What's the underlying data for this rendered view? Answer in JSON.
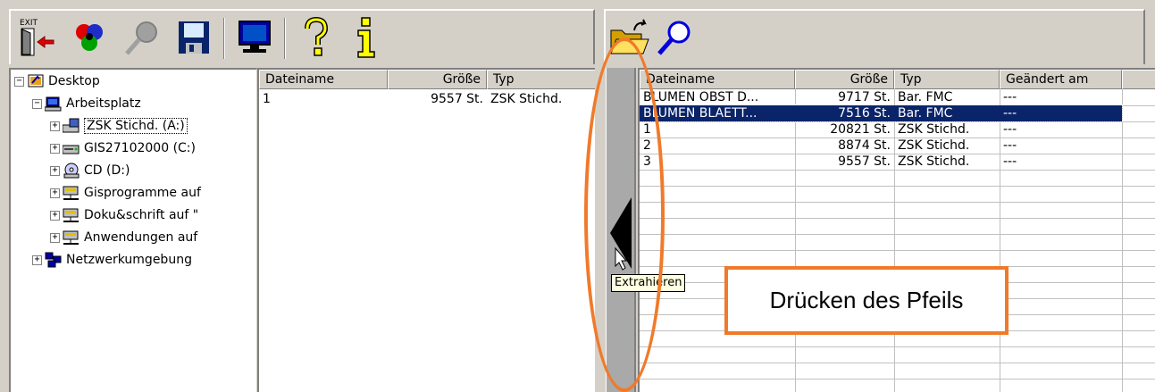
{
  "left_toolbar": {
    "exit_label": "EXIT",
    "icons": [
      "exit-icon",
      "color-circles-icon",
      "magnifier-icon",
      "save-disk-icon",
      "monitor-icon",
      "help-question-icon",
      "info-icon"
    ]
  },
  "right_toolbar": {
    "icons": [
      "open-folder-icon",
      "search-icon"
    ]
  },
  "tree": {
    "items": [
      {
        "label": "Desktop",
        "expander": "−",
        "icon": "desktop-icon"
      },
      {
        "label": "Arbeitsplatz",
        "expander": "−",
        "icon": "computer-icon"
      },
      {
        "label": "ZSK Stichd. (A:)",
        "expander": "+",
        "icon": "floppy-drive-icon"
      },
      {
        "label": "GIS27102000 (C:)",
        "expander": "+",
        "icon": "hard-drive-icon"
      },
      {
        "label": "CD (D:)",
        "expander": "+",
        "icon": "cd-drive-icon"
      },
      {
        "label": "Gisprogramme auf",
        "expander": "+",
        "icon": "network-drive-icon"
      },
      {
        "label": "Doku&schrift auf \"",
        "expander": "+",
        "icon": "network-drive-icon"
      },
      {
        "label": "Anwendungen auf",
        "expander": "+",
        "icon": "network-drive-icon"
      },
      {
        "label": "Netzwerkumgebung",
        "expander": "+",
        "icon": "network-neighborhood-icon"
      }
    ]
  },
  "left_list": {
    "columns": [
      "Dateiname",
      "Größe",
      "Typ"
    ],
    "rows": [
      {
        "name": "1",
        "size": "9557 St.",
        "type": "ZSK Stichd."
      }
    ]
  },
  "right_list": {
    "columns": [
      "Dateiname",
      "Größe",
      "Typ",
      "Geändert am"
    ],
    "rows": [
      {
        "name": "BLUMEN OBST D...",
        "size": "9717 St.",
        "type": "Bar. FMC",
        "changed": "---"
      },
      {
        "name": "BLUMEN BLAETT...",
        "size": "7516 St.",
        "type": "Bar. FMC",
        "changed": "---"
      },
      {
        "name": "1",
        "size": "20821 St.",
        "type": "ZSK Stichd.",
        "changed": "---"
      },
      {
        "name": "2",
        "size": "8874 St.",
        "type": "ZSK Stichd.",
        "changed": "---"
      },
      {
        "name": "3",
        "size": "9557 St.",
        "type": "ZSK Stichd.",
        "changed": "---"
      }
    ],
    "selected_index": 1
  },
  "splitter": {
    "arrow_icon": "extract-arrow-left-icon",
    "tooltip": "Extrahieren"
  },
  "annotation": {
    "callout_text": "Drücken des Pfeils",
    "accent_color": "#f07a2a"
  },
  "colors": {
    "selection": "#0a246a",
    "tooltip_bg": "#ffffe1",
    "face": "#d4d0c8"
  }
}
